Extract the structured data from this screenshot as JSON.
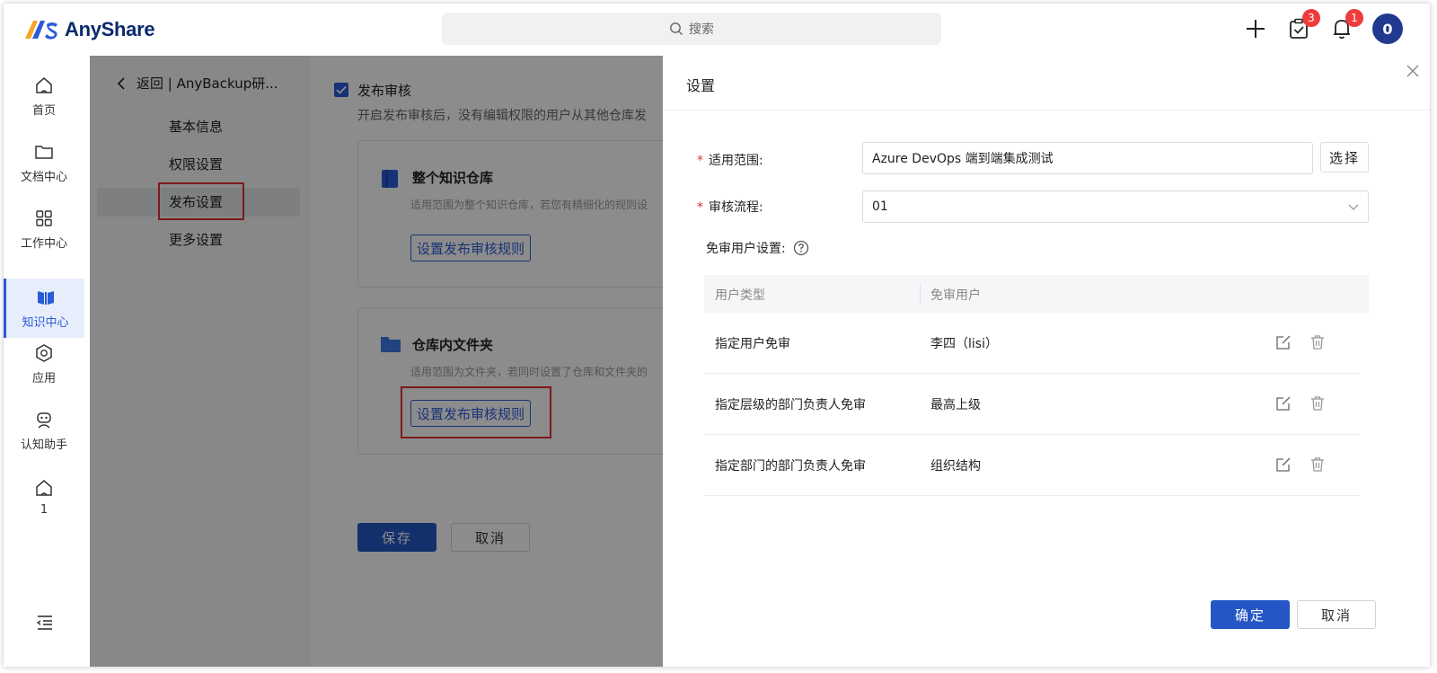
{
  "app": {
    "name": "AnyShare"
  },
  "search": {
    "placeholder": "搜索"
  },
  "topbar": {
    "tasks_badge": "3",
    "notify_badge": "1",
    "avatar_text": "0"
  },
  "leftnav": [
    {
      "label": "首页",
      "icon": "home-icon"
    },
    {
      "label": "文档中心",
      "icon": "folder-icon"
    },
    {
      "label": "工作中心",
      "icon": "grid-icon"
    },
    {
      "label": "知识中心",
      "icon": "book-icon",
      "active": true
    },
    {
      "label": "应用",
      "icon": "app-icon"
    },
    {
      "label": "认知助手",
      "icon": "robot-icon"
    },
    {
      "label": "1",
      "icon": "home-icon"
    }
  ],
  "settings_menu": {
    "back_label": "返回 | AnyBackup研...",
    "items": [
      "基本信息",
      "权限设置",
      "发布设置",
      "更多设置"
    ]
  },
  "publish": {
    "checkbox_label": "发布审核",
    "description": "开启发布审核后，没有编辑权限的用户从其他仓库发",
    "card1": {
      "title": "整个知识仓库",
      "desc": "适用范围为整个知识仓库，若您有精细化的规则设",
      "button": "设置发布审核规则"
    },
    "card2": {
      "title": "仓库内文件夹",
      "desc": "适用范围为文件夹，若同时设置了仓库和文件夹的",
      "button": "设置发布审核规则"
    },
    "save": "保存",
    "cancel": "取消"
  },
  "drawer": {
    "title": "设置",
    "scope_label": "适用范围:",
    "scope_value": "Azure DevOps 端到端集成测试",
    "select_button": "选择",
    "flow_label": "审核流程:",
    "flow_value": "01",
    "exempt_label": "免审用户设置:",
    "table": {
      "headers": [
        "用户类型",
        "免审用户"
      ],
      "rows": [
        {
          "type": "指定用户免审",
          "user": "李四（lisi）"
        },
        {
          "type": "指定层级的部门负责人免审",
          "user": "最高上级"
        },
        {
          "type": "指定部门的部门负责人免审",
          "user": "组织结构"
        }
      ]
    },
    "confirm": "确定",
    "cancel": "取消"
  },
  "colors": {
    "primary": "#2457c5",
    "brand": "#0a2a6e",
    "badge": "#ef3b3b",
    "highlight": "#e03131"
  }
}
